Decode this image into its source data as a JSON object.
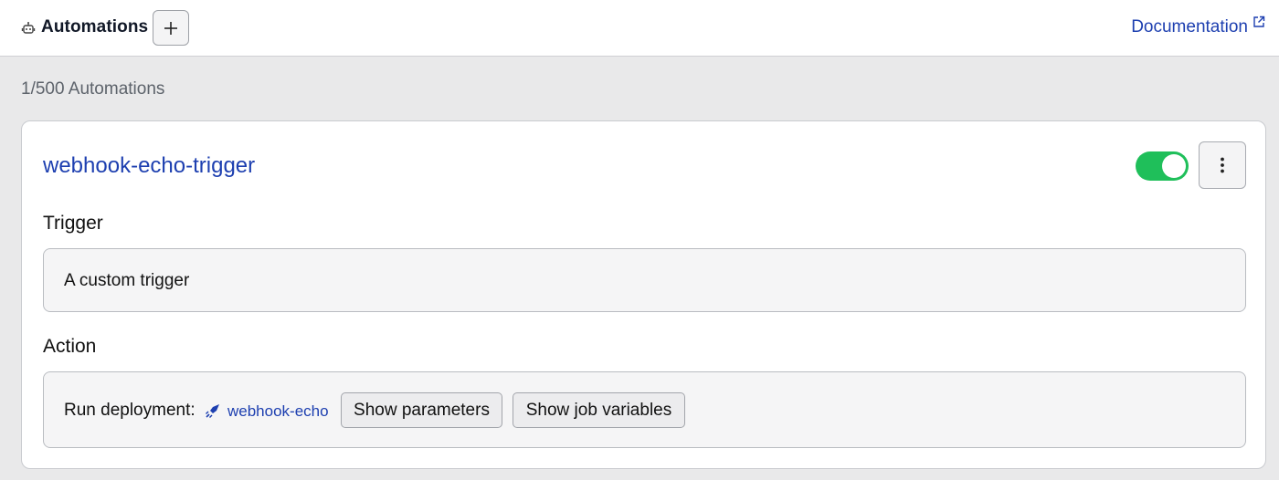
{
  "header": {
    "title": "Automations",
    "documentation_label": "Documentation"
  },
  "summary": {
    "count_text": "1/500 Automations"
  },
  "automation": {
    "name": "webhook-echo-trigger",
    "enabled": true,
    "trigger_heading": "Trigger",
    "trigger_description": "A custom trigger",
    "action_heading": "Action",
    "action_prefix": "Run deployment:",
    "deployment_name": "webhook-echo",
    "show_parameters_label": "Show parameters",
    "show_job_variables_label": "Show job variables"
  },
  "colors": {
    "link": "#1d3fb0",
    "toggle_on": "#1fbf5a"
  }
}
